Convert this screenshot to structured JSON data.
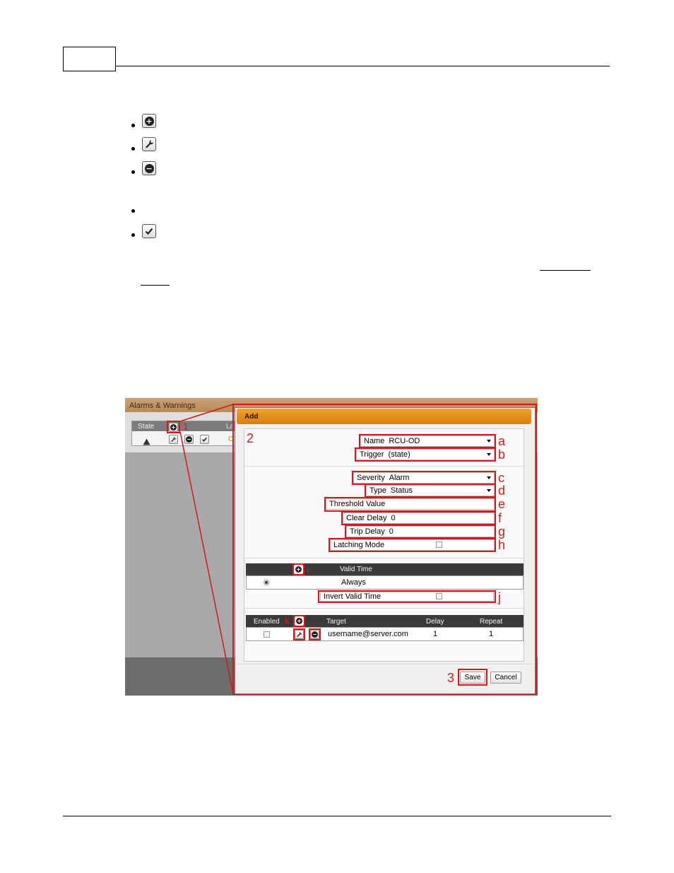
{
  "header": {
    "page_number": ""
  },
  "icons": [
    {
      "name": "add-icon"
    },
    {
      "name": "wrench-icon"
    },
    {
      "name": "remove-icon"
    },
    {
      "name": "blank"
    },
    {
      "name": "acknowledge-icon"
    }
  ],
  "screenshot": {
    "panel_title": "Alarms & Warnings",
    "table": {
      "state_header": "State",
      "second_header_partial": "La",
      "cell_partial": "C"
    },
    "callouts": {
      "c1": "1",
      "c2": "2",
      "c3": "3",
      "a": "a",
      "b": "b",
      "c": "c",
      "d": "d",
      "e": "e",
      "f": "f",
      "g": "g",
      "h": "h",
      "i": "i",
      "j": "j",
      "k": "k"
    },
    "dialog": {
      "title": "Add",
      "name": {
        "label": "Name",
        "value": "RCU-OD"
      },
      "trigger": {
        "label": "Trigger",
        "value": "(state)"
      },
      "severity": {
        "label": "Severity",
        "value": "Alarm"
      },
      "type": {
        "label": "Type",
        "value": "Status"
      },
      "threshold": {
        "label": "Threshold Value",
        "value": ""
      },
      "clear_delay": {
        "label": "Clear Delay",
        "value": "0"
      },
      "trip_delay": {
        "label": "Trip Delay",
        "value": "0"
      },
      "latching": {
        "label": "Latching Mode"
      },
      "valid_time": {
        "header": "Valid Time",
        "row": "Always"
      },
      "invert_valid_time": {
        "label": "Invert Valid Time"
      },
      "targets": {
        "headers": {
          "enabled": "Enabled",
          "target": "Target",
          "delay": "Delay",
          "repeat": "Repeat"
        },
        "row": {
          "target": "username@server.com",
          "delay": "1",
          "repeat": "1"
        }
      },
      "save_label": "Save",
      "cancel_label": "Cancel"
    }
  },
  "colors": {
    "accent": "#e88f1a",
    "callout": "#d41a1a",
    "grid_header": "#3a3a3a"
  }
}
